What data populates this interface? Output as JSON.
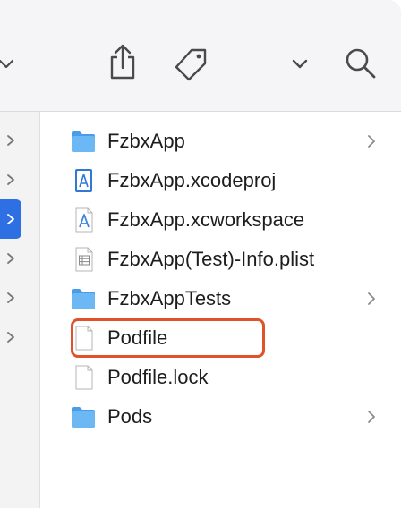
{
  "toolbar": {
    "icons": [
      "chevron-down-icon",
      "share-icon",
      "tag-icon",
      "chevron-down-icon",
      "search-icon"
    ]
  },
  "sidebar": {
    "rows": [
      {
        "icon": "chevron-right-icon",
        "selected": false
      },
      {
        "icon": "chevron-right-icon",
        "selected": false
      },
      {
        "icon": "chevron-right-icon",
        "selected": true
      },
      {
        "icon": "chevron-right-icon",
        "selected": false
      },
      {
        "icon": "chevron-right-icon",
        "selected": false
      },
      {
        "icon": "chevron-right-icon",
        "selected": false
      }
    ]
  },
  "files": [
    {
      "name": "FzbxApp",
      "icon": "folder-icon",
      "has_children": true
    },
    {
      "name": "FzbxApp.xcodeproj",
      "icon": "xcodeproj-icon",
      "has_children": false
    },
    {
      "name": "FzbxApp.xcworkspace",
      "icon": "xcworkspace-icon",
      "has_children": false
    },
    {
      "name": "FzbxApp(Test)-Info.plist",
      "icon": "plist-icon",
      "has_children": false
    },
    {
      "name": "FzbxAppTests",
      "icon": "folder-icon",
      "has_children": true
    },
    {
      "name": "Podfile",
      "icon": "document-icon",
      "has_children": false,
      "highlighted": true
    },
    {
      "name": "Podfile.lock",
      "icon": "document-icon",
      "has_children": false
    },
    {
      "name": "Pods",
      "icon": "folder-icon",
      "has_children": true
    }
  ],
  "colors": {
    "selection": "#2e6fe4",
    "highlight_border": "#e0532a",
    "folder": "#5aaef0"
  }
}
